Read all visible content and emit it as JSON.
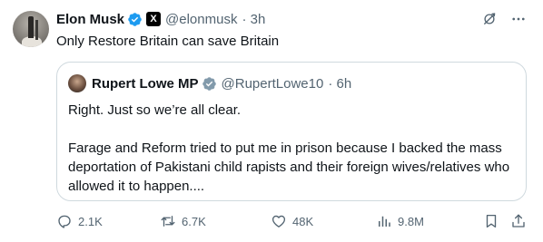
{
  "post": {
    "author_name": "Elon Musk",
    "author_handle": "@elonmusk",
    "time": "· 3h",
    "text": "Only Restore Britain can save Britain",
    "x_badge": "X"
  },
  "quoted_post": {
    "author_name": "Rupert Lowe MP",
    "author_handle": "@RupertLowe10",
    "time": "· 6h",
    "paragraphs": [
      "Right. Just so we’re all clear.",
      "Farage and Reform tried to put me in prison because I backed the mass deportation of Pakistani child rapists and their foreign wives/relatives who allowed it to happen...."
    ]
  },
  "actions": {
    "replies": "2.1K",
    "reposts": "6.7K",
    "likes": "48K",
    "views": "9.8M"
  },
  "colors": {
    "verified": "#1d9bf0",
    "muted": "#536471",
    "border": "#cfd9de",
    "text": "#0f1419"
  },
  "icons": [
    "verified-badge-icon",
    "x-logo-icon",
    "grok-icon",
    "more-icon",
    "reply-icon",
    "repost-icon",
    "like-icon",
    "views-icon",
    "bookmark-icon",
    "share-icon"
  ]
}
